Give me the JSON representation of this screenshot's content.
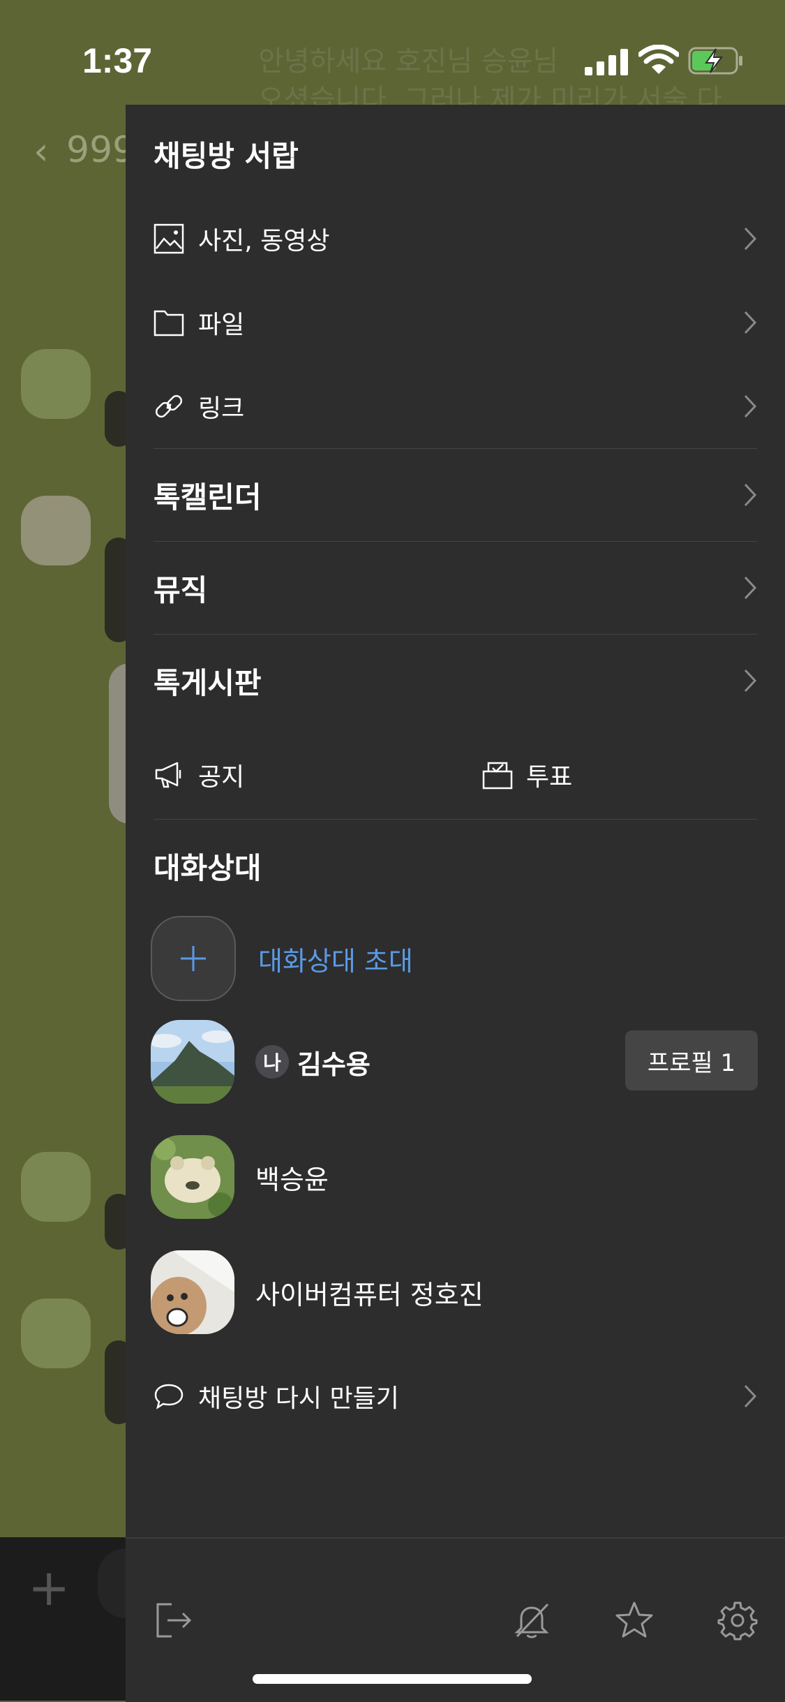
{
  "status_bar": {
    "time": "1:37"
  },
  "background_chat": {
    "back_count": "999",
    "message_line1": "안녕하세요 호진님 승윤님",
    "message_line2": "오셨습니다. 그러나 제가 미리가 서술 다"
  },
  "drawer": {
    "title": "채팅방 서랍",
    "media": {
      "photos_label": "사진, 동영상",
      "files_label": "파일",
      "links_label": "링크"
    },
    "sections": {
      "talk_calendar": "톡캘린더",
      "music": "뮤직",
      "talk_board": "톡게시판"
    },
    "quick": {
      "notice_label": "공지",
      "poll_label": "투표"
    },
    "members": {
      "title": "대화상대",
      "invite_label": "대화상대 초대",
      "me_badge": "나",
      "list": [
        {
          "name": "김수용",
          "is_me": true,
          "profile_button": "프로필 1"
        },
        {
          "name": "백승윤",
          "is_me": false
        },
        {
          "name": "사이버컴퓨터 정호진",
          "is_me": false
        }
      ]
    },
    "recreate_label": "채팅방 다시 만들기"
  },
  "colors": {
    "drawer_bg": "#2d2d2d",
    "chat_bg": "#5d6535",
    "accent_blue": "#5a9ae6",
    "battery_green": "#5ac95a"
  },
  "icons": [
    "photo-icon",
    "folder-icon",
    "link-icon",
    "megaphone-icon",
    "vote-icon",
    "plus-icon",
    "speech-bubble-icon",
    "exit-icon",
    "bell-off-icon",
    "star-icon",
    "gear-icon"
  ]
}
